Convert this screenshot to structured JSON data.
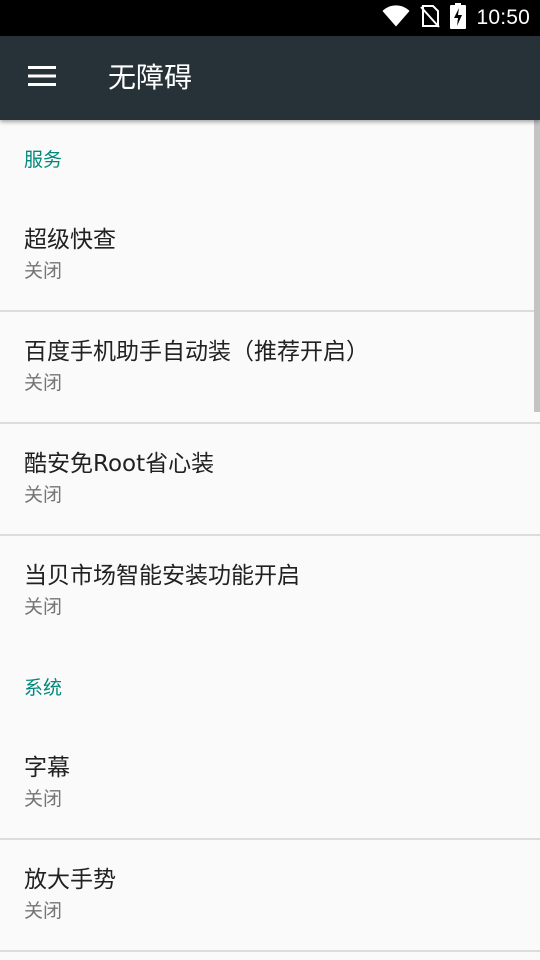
{
  "status_bar": {
    "time": "10:50",
    "icons": [
      "wifi-icon",
      "no-sim-icon",
      "battery-charging-icon"
    ]
  },
  "app_bar": {
    "title": "无障碍",
    "menu_icon": "hamburger-menu-icon"
  },
  "sections": [
    {
      "header": "服务",
      "items": [
        {
          "title": "超级快查",
          "summary": "关闭"
        },
        {
          "title": "百度手机助手自动装（推荐开启）",
          "summary": "关闭"
        },
        {
          "title": "酷安免Root省心装",
          "summary": "关闭"
        },
        {
          "title": "当贝市场智能安装功能开启",
          "summary": "关闭"
        }
      ]
    },
    {
      "header": "系统",
      "items": [
        {
          "title": "字幕",
          "summary": "关闭"
        },
        {
          "title": "放大手势",
          "summary": "关闭"
        }
      ]
    }
  ],
  "colors": {
    "app_bar": "#263238",
    "accent": "#00897b",
    "background": "#fafafa"
  }
}
